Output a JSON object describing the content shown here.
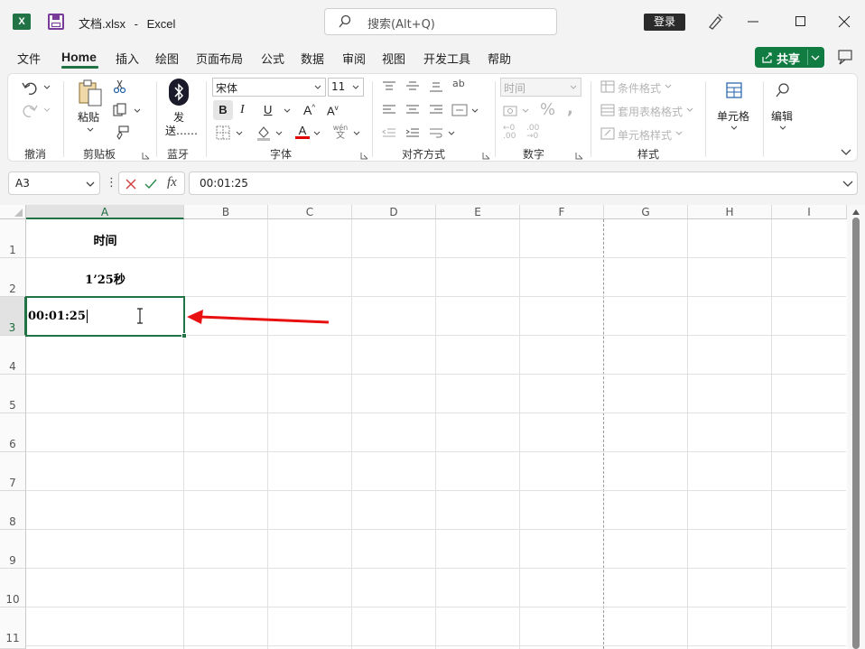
{
  "titlebar": {
    "filename": "文档.xlsx",
    "separator": "-",
    "app": "Excel",
    "search_placeholder": "搜索(Alt+Q)",
    "login_label": "登录"
  },
  "menu": {
    "tabs": [
      "文件",
      "Home",
      "插入",
      "绘图",
      "页面布局",
      "公式",
      "数据",
      "审阅",
      "视图",
      "开发工具",
      "帮助"
    ],
    "share_label": "共享"
  },
  "ribbon": {
    "groups": {
      "undo": "撤消",
      "clipboard": "剪贴板",
      "bluetooth": "蓝牙",
      "font": "字体",
      "alignment": "对齐方式",
      "number": "数字",
      "styles": "样式"
    },
    "paste_label": "粘贴",
    "send_label_1": "发",
    "send_label_2": "送……",
    "font_name": "宋体",
    "font_size": "11",
    "number_format": "时间",
    "conditional_format": "条件格式",
    "table_format": "套用表格格式",
    "cell_styles": "单元格样式",
    "cells_label": "单元格",
    "edit_label": "编辑",
    "bold": "B",
    "italic": "I",
    "underline": "U",
    "wen_label": "wén"
  },
  "formula_bar": {
    "name_box": "A3",
    "fx": "fx",
    "value": "00:01:25"
  },
  "sheet": {
    "columns": [
      "A",
      "B",
      "C",
      "D",
      "E",
      "F",
      "G",
      "H",
      "I"
    ],
    "rows": [
      "1",
      "2",
      "3",
      "4",
      "5",
      "6",
      "7",
      "8",
      "9",
      "10",
      "11"
    ],
    "cells": {
      "A1": "时间",
      "A2": "1’25秒",
      "A3": "00:01:25"
    },
    "selected_cell": "A3"
  },
  "colors": {
    "excel_green": "#217346",
    "share_green": "#107c41",
    "arrow_red": "#e81010",
    "font_color_red": "#e00000"
  }
}
